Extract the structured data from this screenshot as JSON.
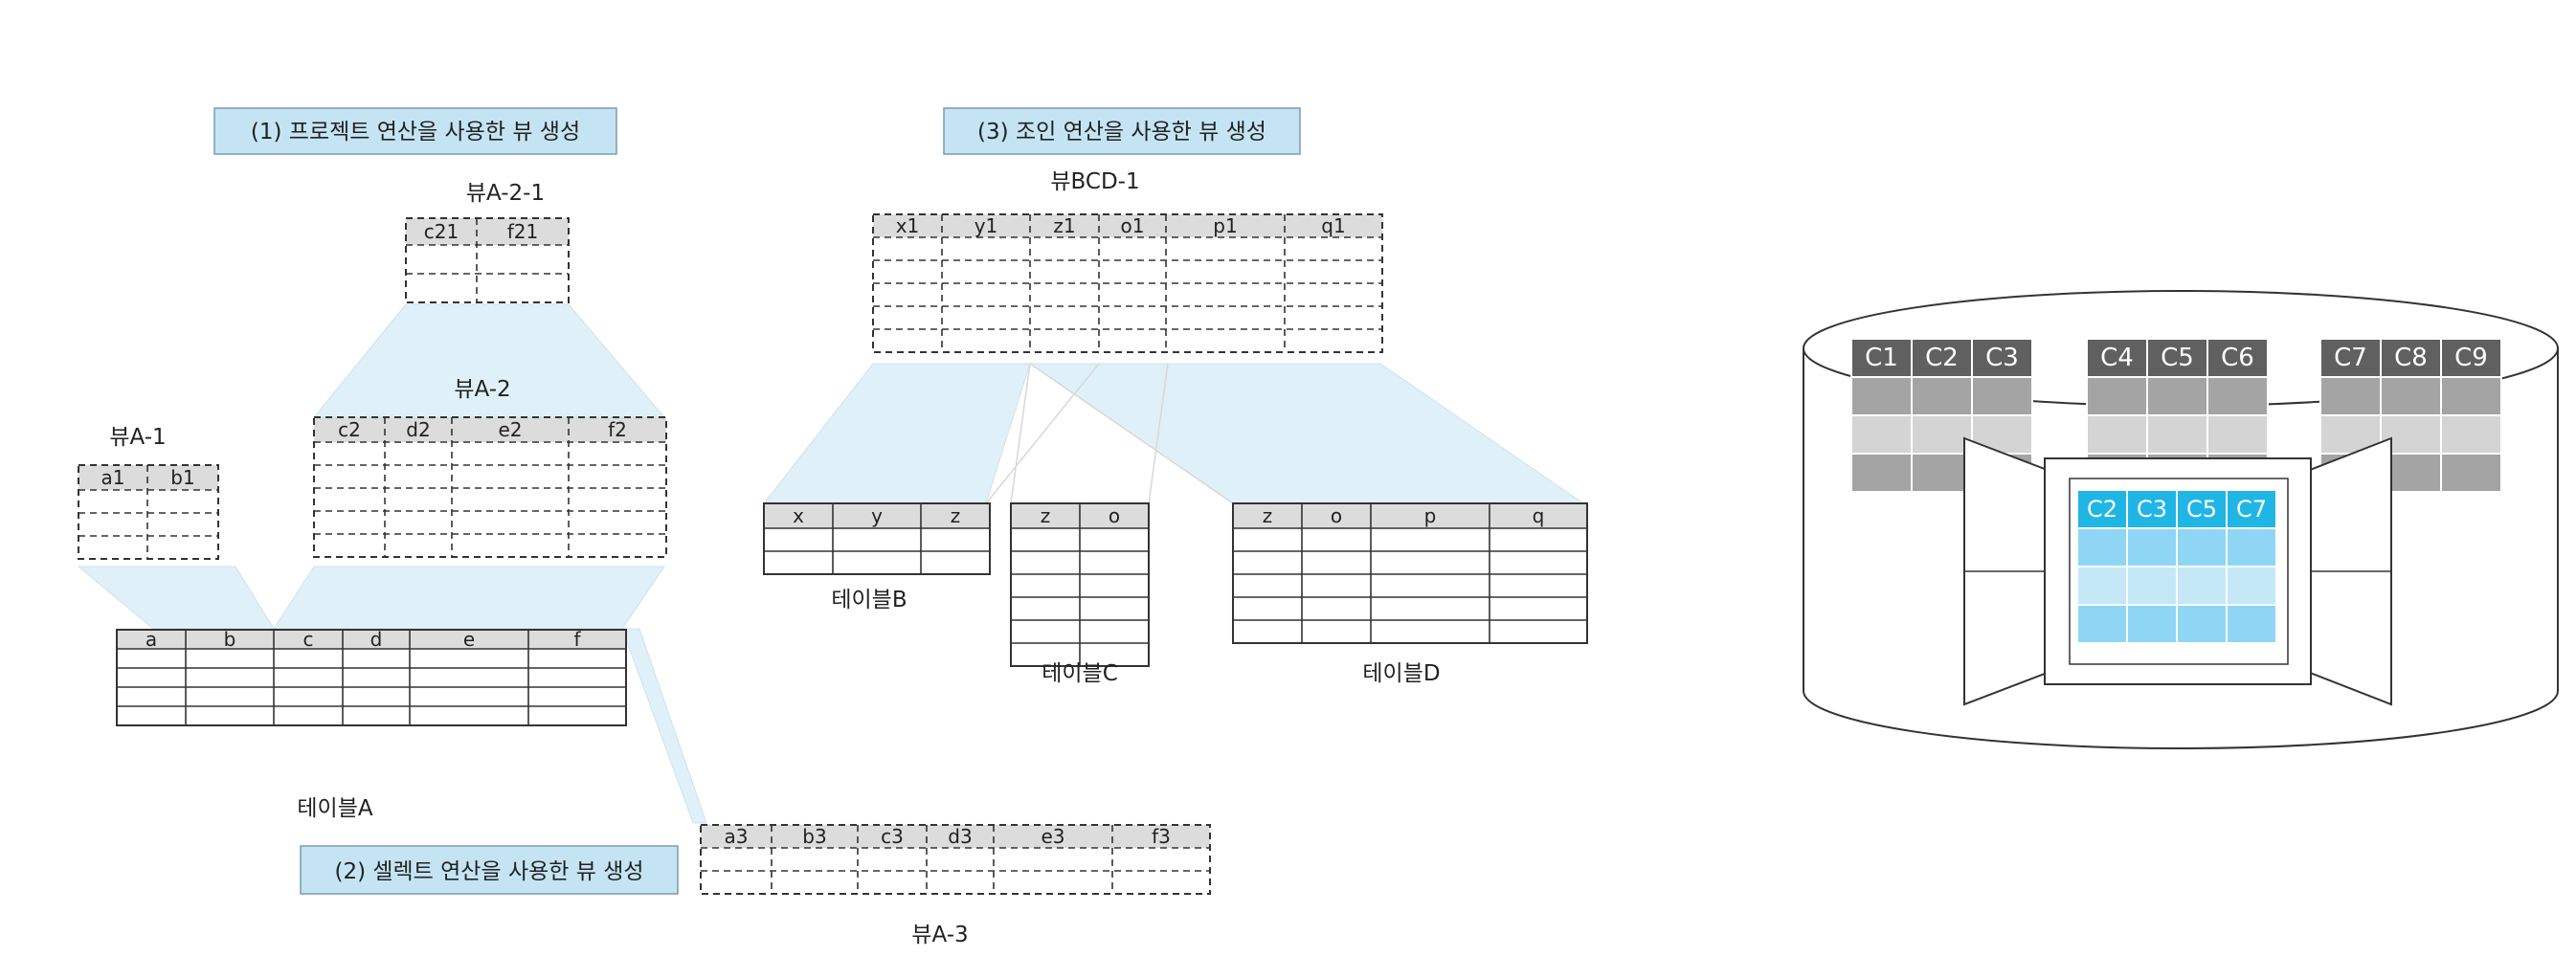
{
  "captions": {
    "project": "(1) 프로젝트 연산을 사용한 뷰 생성",
    "select": "(2) 셀렉트 연산을 사용한 뷰 생성",
    "join": "(3) 조인 연산을 사용한 뷰 생성"
  },
  "tables": {
    "tableA": {
      "name": "테이블A",
      "columns": [
        "a",
        "b",
        "c",
        "d",
        "e",
        "f"
      ]
    },
    "viewA1": {
      "name": "뷰A-1",
      "columns": [
        "a1",
        "b1"
      ]
    },
    "viewA2": {
      "name": "뷰A-2",
      "columns": [
        "c2",
        "d2",
        "e2",
        "f2"
      ]
    },
    "viewA21": {
      "name": "뷰A-2-1",
      "columns": [
        "c21",
        "f21"
      ]
    },
    "viewA3": {
      "name": "뷰A-3",
      "columns": [
        "a3",
        "b3",
        "c3",
        "d3",
        "e3",
        "f3"
      ]
    },
    "viewBCD1": {
      "name": "뷰BCD-1",
      "columns": [
        "x1",
        "y1",
        "z1",
        "o1",
        "p1",
        "q1"
      ]
    },
    "tableB": {
      "name": "테이블B",
      "columns": [
        "x",
        "y",
        "z"
      ]
    },
    "tableC": {
      "name": "테이블C",
      "columns": [
        "z",
        "o"
      ]
    },
    "tableD": {
      "name": "테이블D",
      "columns": [
        "z",
        "o",
        "p",
        "q"
      ]
    }
  },
  "database": {
    "groups": [
      [
        "C1",
        "C2",
        "C3"
      ],
      [
        "C4",
        "C5",
        "C6"
      ],
      [
        "C7",
        "C8",
        "C9"
      ]
    ],
    "view_columns": [
      "C2",
      "C3",
      "C5",
      "C7"
    ]
  },
  "colors": {
    "highlight": "#dff0f8",
    "view_header": "#dcdcdc",
    "caption_box": "#c4e4f4",
    "db_header": "#606060",
    "db_row_dark": "#a4a4a4",
    "db_row_light": "#d4d4d4",
    "view_accent": "#1fb6e6",
    "view_light": "#8fd6f4",
    "view_lighter": "#c4e8f8"
  }
}
